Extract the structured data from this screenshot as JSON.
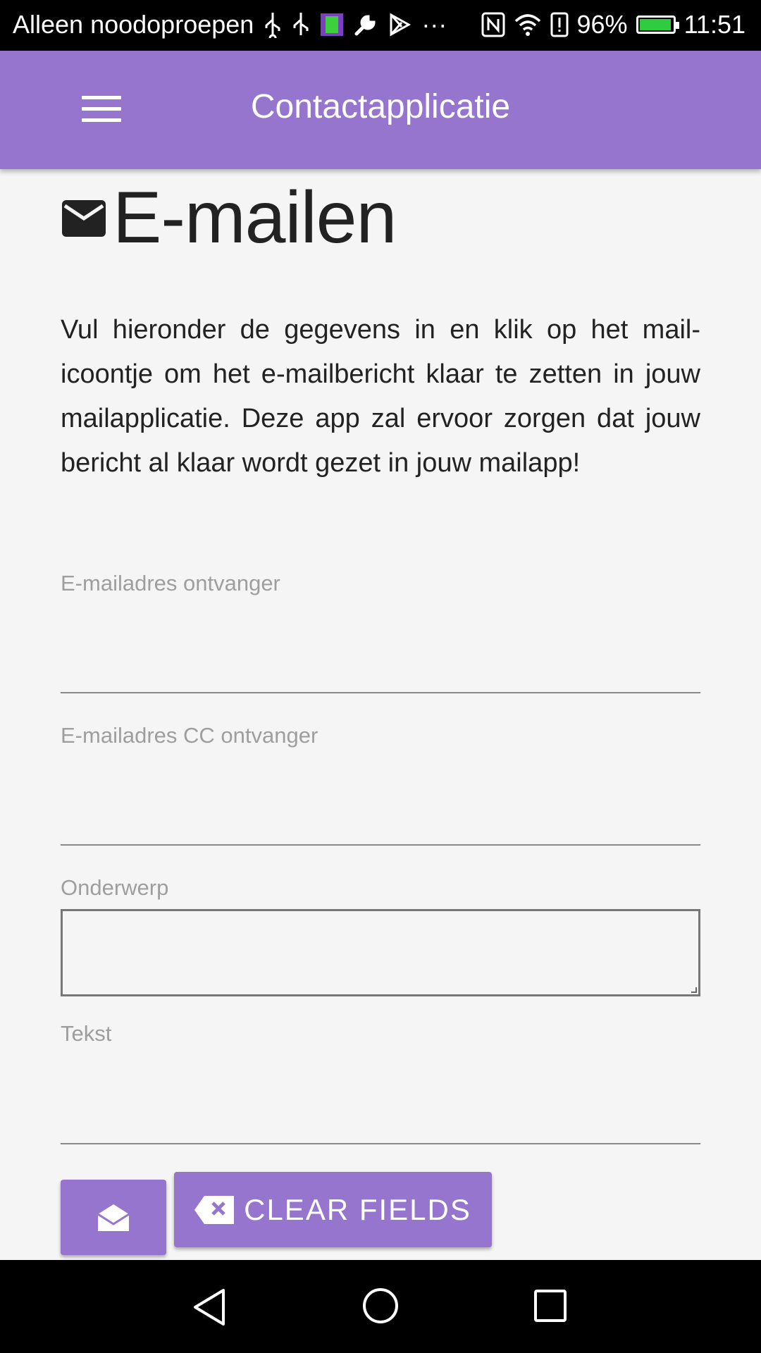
{
  "status_bar": {
    "carrier": "Alleen noodoproepen",
    "overflow": "···",
    "battery": "96%",
    "time": "11:51",
    "icons": [
      "usb-icon",
      "usb-icon",
      "sim-app-icon",
      "wrench-icon",
      "play-store-icon",
      "nfc-icon",
      "wifi-icon",
      "alert-icon",
      "battery-icon"
    ]
  },
  "app_bar": {
    "title": "Contactapplicatie"
  },
  "page": {
    "title": "E-mailen",
    "intro": "Vul hieronder de gegevens in en klik op het mail-icoontje om het e-mailbericht klaar te zetten in jouw mailapplicatie. Deze app zal ervoor zorgen dat jouw bericht al klaar wordt gezet in jouw mailapp!"
  },
  "form": {
    "to_label": "E-mailadres ontvanger",
    "to_value": "",
    "cc_label": "E-mailadres CC ontvanger",
    "cc_value": "",
    "subject_label": "Onderwerp",
    "subject_value": "",
    "text_label": "Tekst",
    "text_value": ""
  },
  "buttons": {
    "clear_label": "CLEAR FIELDS"
  },
  "colors": {
    "accent": "#9575cd",
    "background": "#f5f5f5"
  }
}
